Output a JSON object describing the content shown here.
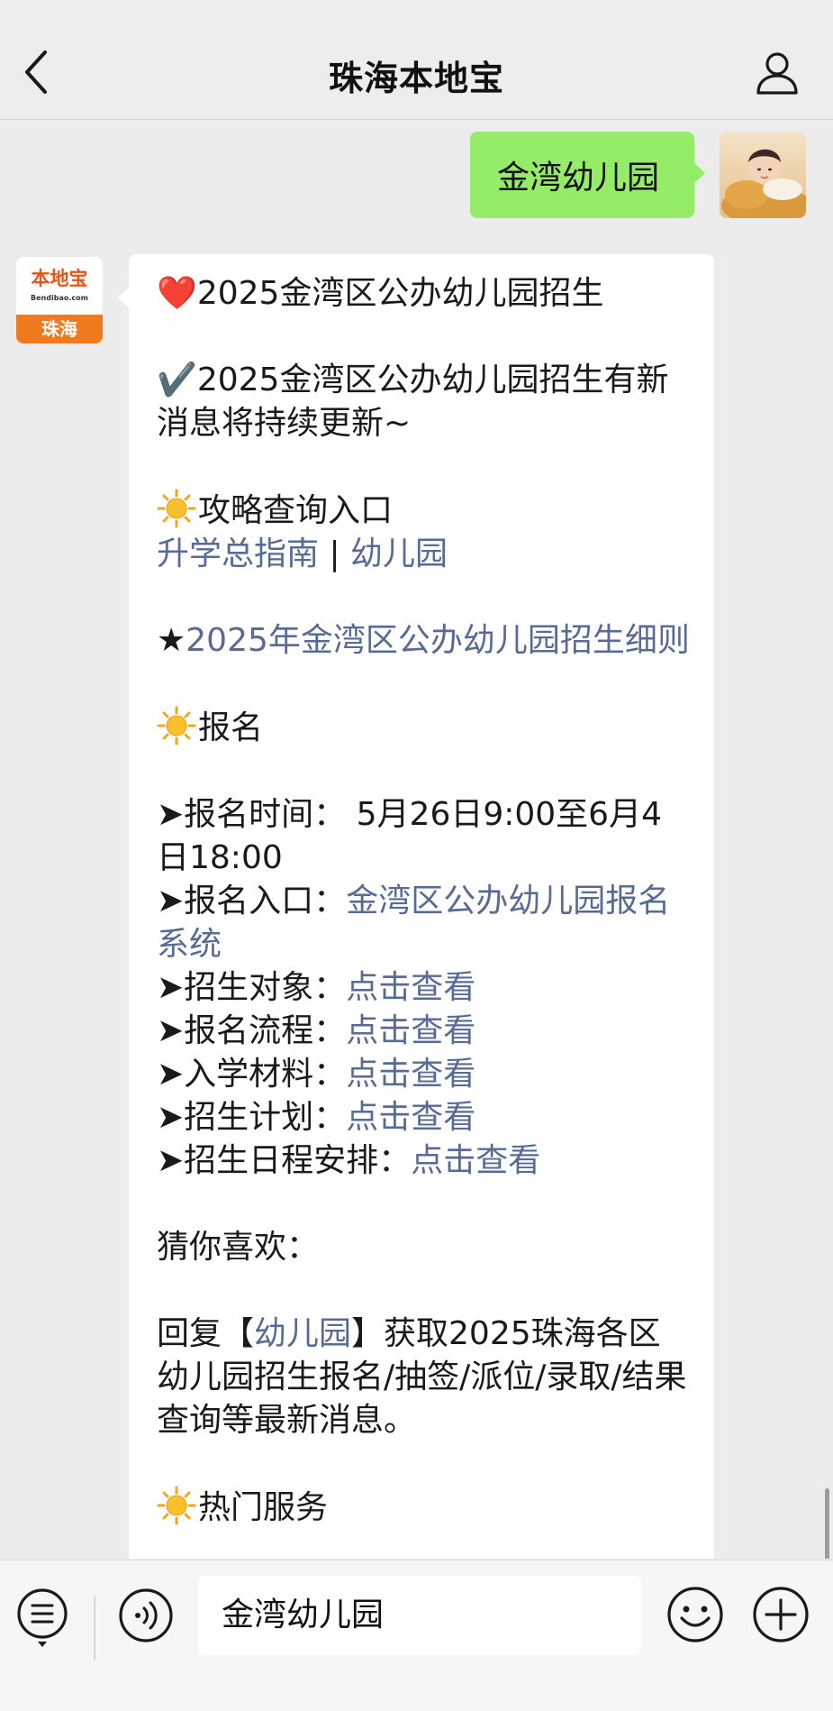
{
  "header": {
    "title": "珠海本地宝"
  },
  "colors": {
    "link": "#576b95",
    "outgoing_bubble": "#95ec69",
    "brand_orange": "#f0791e"
  },
  "icons": {
    "back": "chevron-left-icon",
    "user": "person-icon",
    "menu": "list-menu-icon",
    "voice": "voice-icon",
    "emoji": "smiley-icon",
    "plus": "plus-icon"
  },
  "outgoing_message": "金湾幼儿园",
  "bot_avatar": {
    "brand": "本地宝",
    "domain": "Bendibao.com",
    "city": "珠海"
  },
  "message": {
    "line1_icon": "❤️",
    "line1": "2025金湾区公办幼儿园招生",
    "line2_icon": "✔️",
    "line2": "2025金湾区公办幼儿园招生有新消息将持续更新~",
    "section1_title": "攻略查询入口",
    "guide_link": "升学总指南",
    "separator": " | ",
    "kindergarten_link": "幼儿园",
    "star": "★",
    "rules_link": "2025年金湾区公办幼儿园招生细则",
    "section2_title": "报名",
    "arrow": "➤",
    "reg_time_label": "报名时间：",
    "reg_time_value": " 5月26日9:00至6月4日18:00",
    "reg_entry_label": "报名入口：",
    "reg_entry_link": "金湾区公办幼儿园报名系统",
    "items": [
      {
        "label": "招生对象：",
        "link": "点击查看"
      },
      {
        "label": "报名流程：",
        "link": "点击查看"
      },
      {
        "label": "入学材料：",
        "link": "点击查看"
      },
      {
        "label": "招生计划：",
        "link": "点击查看"
      },
      {
        "label": "招生日程安排：",
        "link": "点击查看"
      }
    ],
    "guess_title": "猜你喜欢：",
    "reply_prefix": "回复【",
    "reply_link": "幼儿园",
    "reply_suffix": "】获取2025珠海各区幼儿园招生报名/抽签/派位/录取/结果查询等最新消息。",
    "section3_title": "热门服务"
  },
  "input": {
    "value": "金湾幼儿园"
  }
}
